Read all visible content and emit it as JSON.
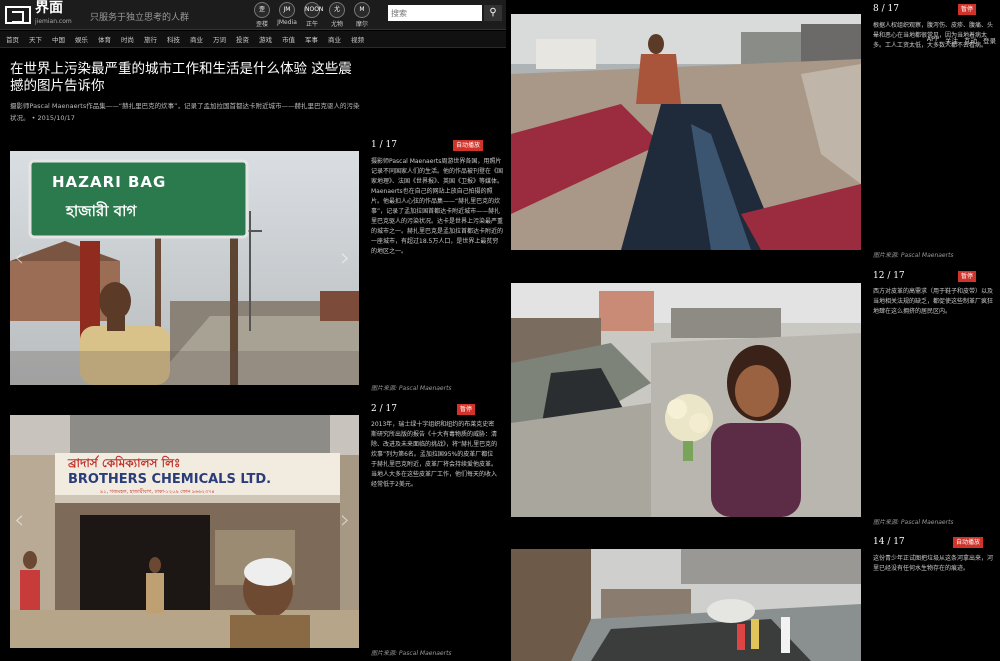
{
  "header": {
    "logo_name": "界面",
    "logo_domain": "jiemian.com",
    "slogan": "只服务于独立思考的人群",
    "channels": [
      {
        "label": "歪楼",
        "icon": "歪"
      },
      {
        "label": "JMedia",
        "icon": "JM"
      },
      {
        "label": "正午",
        "icon": "NOON"
      },
      {
        "label": "尤物",
        "icon": "尤"
      },
      {
        "label": "摩尔",
        "icon": "M"
      }
    ],
    "search_placeholder": "搜索",
    "search_icon": "search-icon"
  },
  "nav": {
    "items": [
      "首页",
      "天下",
      "中国",
      "娱乐",
      "体育",
      "时尚",
      "旅行",
      "科技",
      "商业",
      "万词",
      "投资",
      "游戏",
      "市值",
      "军事",
      "商业",
      "视频"
    ],
    "right": [
      "APP",
      "关注",
      "互动",
      "登录"
    ]
  },
  "article": {
    "title": "在世界上污染最严重的城市工作和生活是什么体验 这些震撼的图片告诉你",
    "subtitle": "摄影师Pascal Maenaerts作品集——“赫扎里巴克的炊事”，记录了孟加拉国首都达卡附近城市——赫扎里巴克驱人的污染状况。 • 2015/10/17"
  },
  "slides": [
    {
      "counter": "1 / 17",
      "badge": "自动播放",
      "text": "摄影师Pascal Maenaerts周游世界各国，用照片记录不同国家人们的生活。他的作品被刊登在《国家地理》、法国《世界报》、英国《卫报》等媒体。Maenaerts也在自己的网站上放自己拍摄的照片。他最扣人心弦的作品集——“赫扎里巴克的炊事”，记录了孟加拉国首都达卡附近城市——赫扎里巴克驱人的污染状况。达卡是世界上污染最严重的城市之一。赫扎里巴克是孟加拉首都达卡附近的一座城市，有超过18.5万人口，是世界上最贫穷的地区之一。",
      "credit": "图片来源: Pascal Maenaerts",
      "sign_line1": "HAZARI BAG",
      "sign_line2": "হাজারী বাগ"
    },
    {
      "counter": "2 / 17",
      "badge": "暂停",
      "text": "2013年，瑞士绿十字组织和纽约的布莱克史密斯研究所出版的报告《十大有毒物质的威胁：清除、改进及未来面临的挑战》，将“赫扎里巴克的炊事”列为第6名。孟加拉国95%的皮革厂都位于赫扎里巴克附近，皮革厂将会持续爱他皮革。当地人大多在这些皮革厂工作，他们每天的收入经常低于2美元。",
      "credit": "图片来源: Pascal Maenaerts",
      "sign_line1": "ব্রাদার্স কেমিক্যালস লিঃ",
      "sign_line2": "BROTHERS CHEMICALS LTD.",
      "sign_line3": "৯১, গজমহল, হাজারীবাগ, ঢাকা-১২০৯ ফোন ৯৬৬২৩৭৪"
    },
    {
      "counter": "8 / 17",
      "badge": "暂停",
      "text": "根据人权组织观察，腹泻伤、皮疹、腹痛、头晕和恶心在当地都很常见，因为当地着病太多。工人工资太低，大多数人都不去看病。",
      "credit": "图片来源: Pascal Maenaerts"
    },
    {
      "counter": "12 / 17",
      "badge": "暂停",
      "text": "西方对皮革的高需求（用于鞋子和皮带）以及当地相关法规的缺乏，都促使这些制革厂疯狂地肆在这么拥挤的居民区内。",
      "credit": "图片来源: Pascal Maenaerts"
    },
    {
      "counter": "14 / 17",
      "badge": "自动播放",
      "text": "这份青少年正试图把垃圾从这条河拿出来，河里已经没有任何水生物存在的痕迹。",
      "credit": ""
    }
  ],
  "colors": {
    "badge": "#d0332a",
    "background": "#000000",
    "topbar": "#1c1c1c"
  }
}
